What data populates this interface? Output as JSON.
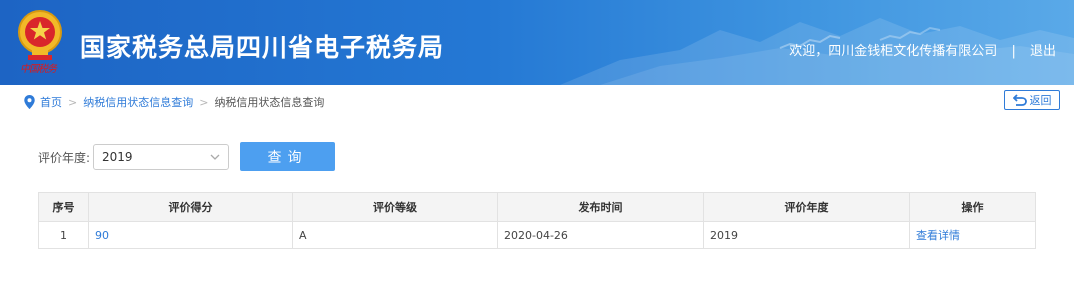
{
  "header": {
    "seal_text": "中国税务",
    "title": "国家税务总局四川省电子税务局",
    "welcome": "欢迎，四川金钱柜文化传播有限公司",
    "separator": "|",
    "logout": "退出"
  },
  "breadcrumb": {
    "items": [
      "首页",
      "纳税信用状态信息查询",
      "纳税信用状态信息查询"
    ],
    "separator": ">"
  },
  "back_button": {
    "label": "返回"
  },
  "search": {
    "year_label": "评价年度:",
    "year_value": "2019",
    "query_label": "查询"
  },
  "table": {
    "headers": [
      "序号",
      "评价得分",
      "评价等级",
      "发布时间",
      "评价年度",
      "操作"
    ],
    "rows": [
      {
        "index": "1",
        "score": "90",
        "grade": "A",
        "publish_date": "2020-04-26",
        "year": "2019",
        "action": "查看详情"
      }
    ]
  },
  "colors": {
    "header_blue": "#2478d4",
    "link_blue": "#2f7bd8",
    "button_blue": "#4d9ff0"
  }
}
